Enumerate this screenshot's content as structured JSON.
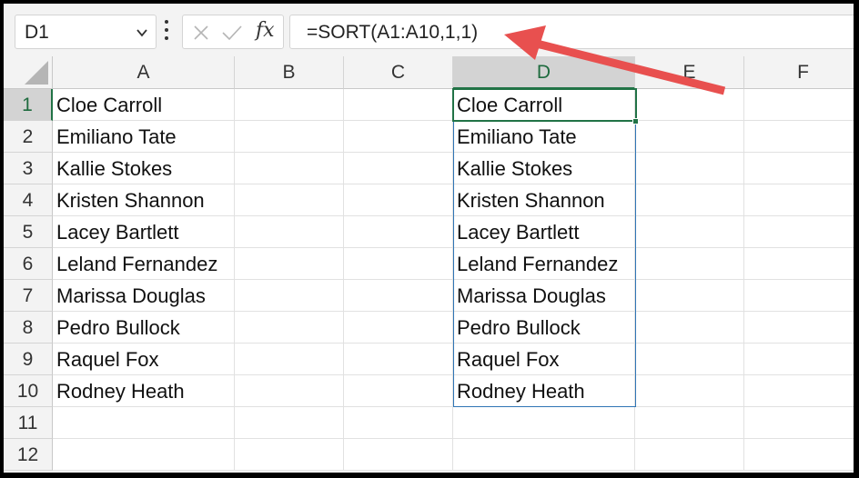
{
  "name_box": {
    "value": "D1"
  },
  "formula_bar": {
    "fx_label": "fx",
    "formula": "=SORT(A1:A10,1,1)"
  },
  "columns": [
    "A",
    "B",
    "C",
    "D",
    "E",
    "F"
  ],
  "rows": [
    "1",
    "2",
    "3",
    "4",
    "5",
    "6",
    "7",
    "8",
    "9",
    "10",
    "11",
    "12"
  ],
  "column_a": [
    "Cloe Carroll",
    "Emiliano Tate",
    "Kallie Stokes",
    "Kristen Shannon",
    "Lacey Bartlett",
    "Leland Fernandez",
    "Marissa Douglas",
    "Pedro Bullock",
    "Raquel Fox",
    "Rodney Heath"
  ],
  "column_d": [
    "Cloe Carroll",
    "Emiliano Tate",
    "Kallie Stokes",
    "Kristen Shannon",
    "Lacey Bartlett",
    "Leland Fernandez",
    "Marissa Douglas",
    "Pedro Bullock",
    "Raquel Fox",
    "Rodney Heath"
  ],
  "colors": {
    "selection_green": "#217346",
    "spill_blue": "#2f75b5",
    "arrow_red": "#e8504f"
  }
}
